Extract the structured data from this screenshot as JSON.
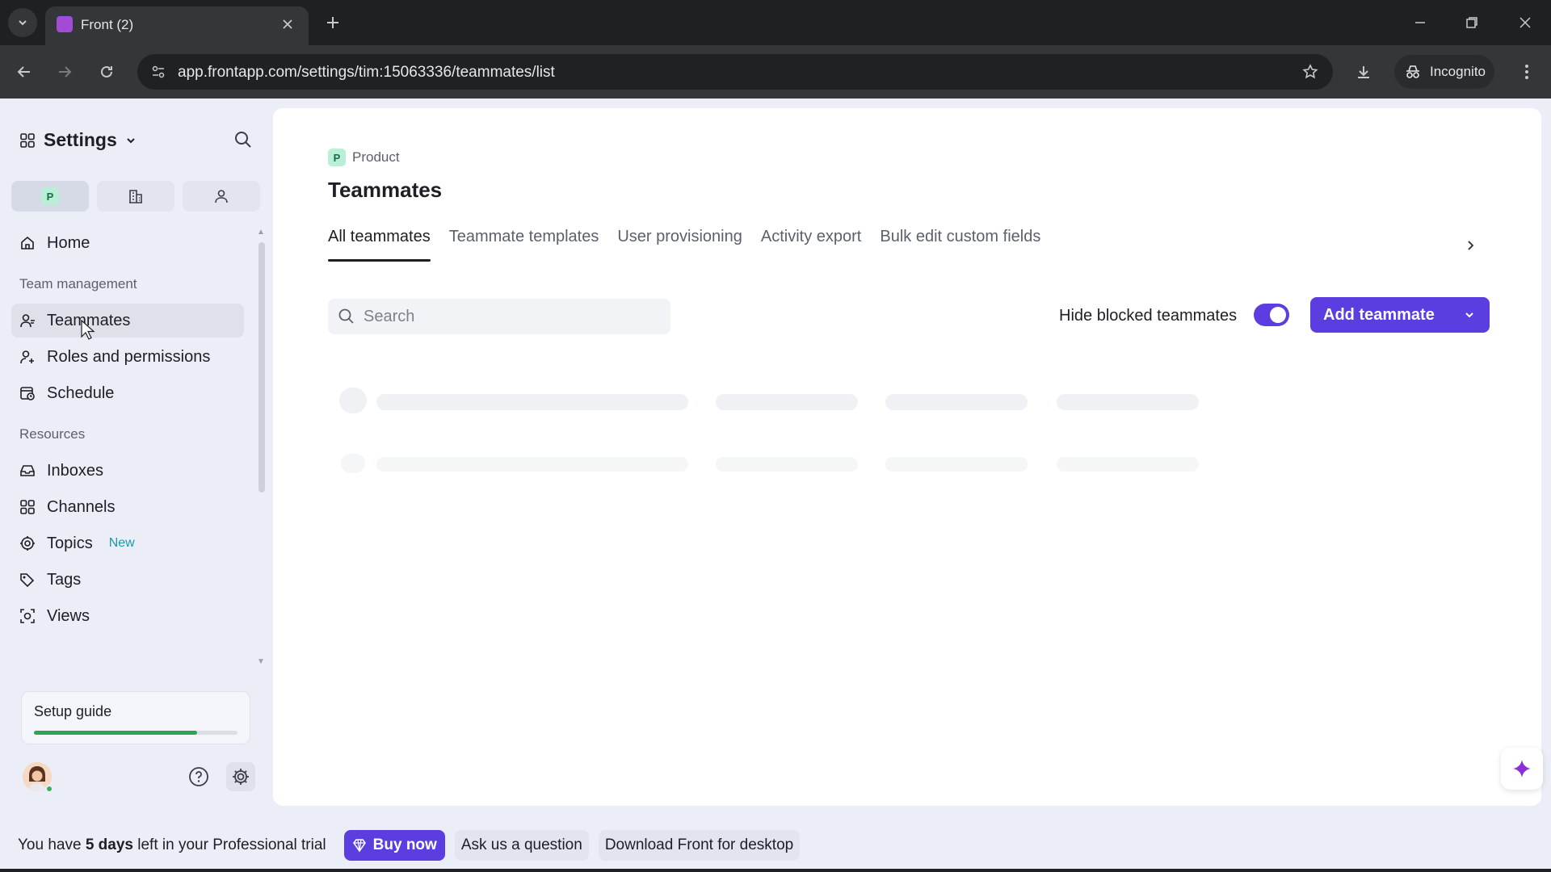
{
  "browser": {
    "tab_title": "Front (2)",
    "url": "app.frontapp.com/settings/tim:15063336/teammates/list",
    "incognito_label": "Incognito"
  },
  "sidebar": {
    "title": "Settings",
    "scope_badge": "P",
    "home_label": "Home",
    "section_team": "Team management",
    "team_items": [
      {
        "label": "Teammates"
      },
      {
        "label": "Roles and permissions"
      },
      {
        "label": "Schedule"
      }
    ],
    "section_resources": "Resources",
    "resource_items": [
      {
        "label": "Inboxes"
      },
      {
        "label": "Channels"
      },
      {
        "label": "Topics",
        "badge": "New"
      },
      {
        "label": "Tags"
      },
      {
        "label": "Views"
      }
    ],
    "setup_guide_label": "Setup guide",
    "setup_guide_progress": 0.8
  },
  "main": {
    "breadcrumb_badge": "P",
    "breadcrumb_label": "Product",
    "title": "Teammates",
    "tabs": [
      {
        "label": "All teammates",
        "active": true
      },
      {
        "label": "Teammate templates"
      },
      {
        "label": "User provisioning"
      },
      {
        "label": "Activity export"
      },
      {
        "label": "Bulk edit custom fields"
      }
    ],
    "search_placeholder": "Search",
    "hide_blocked_label": "Hide blocked teammates",
    "hide_blocked_on": true,
    "add_button_label": "Add teammate"
  },
  "trial_bar": {
    "text_prefix": "You have ",
    "days": "5 days",
    "text_suffix": " left in your Professional trial",
    "buy_label": "Buy now",
    "ask_label": "Ask us a question",
    "download_label": "Download Front for desktop"
  },
  "colors": {
    "accent": "#5b3de0",
    "progress": "#2fa352",
    "new_badge": "#1a9aa4"
  }
}
